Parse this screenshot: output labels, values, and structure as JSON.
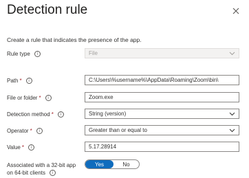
{
  "dialog": {
    "title": "Detection rule",
    "subtitle": "Create a rule that indicates the presence of the app."
  },
  "fields": {
    "rule_type": {
      "label": "Rule type",
      "value": "File"
    },
    "path": {
      "label": "Path",
      "value": "C:\\Users\\%username%\\AppData\\Roaming\\Zoom\\bin\\"
    },
    "file_or_folder": {
      "label": "File or folder",
      "value": "Zoom.exe"
    },
    "detection_method": {
      "label": "Detection method",
      "value": "String (version)"
    },
    "operator": {
      "label": "Operator",
      "value": "Greater than or equal to"
    },
    "value": {
      "label": "Value",
      "value": "5.17.28914"
    },
    "bit32": {
      "label_line1": "Associated with a 32-bit app",
      "label_line2": "on 64-bit clients",
      "yes": "Yes",
      "no": "No",
      "selected": "Yes"
    }
  },
  "symbols": {
    "required": "*",
    "info": "i"
  },
  "colors": {
    "accent": "#0f6cbd",
    "required": "#a4262c"
  }
}
